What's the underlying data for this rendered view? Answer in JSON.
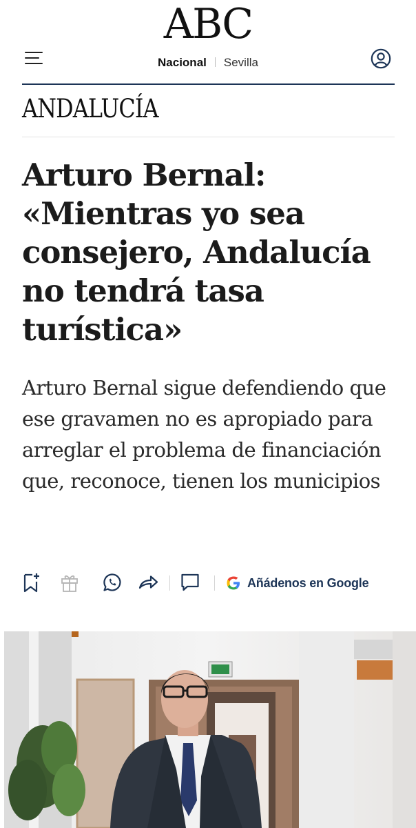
{
  "header": {
    "logo": "ABC",
    "edition": "Nacional",
    "city": "Sevilla",
    "menu_icon": "hamburger-menu-icon",
    "user_icon": "user-account-icon"
  },
  "section": "ANDALUCÍA",
  "article": {
    "headline": "Arturo Bernal: «Mientras yo sea consejero, Andalucía no tendrá tasa turística»",
    "subtitle": "Arturo Bernal sigue defendiendo que ese gravamen no es apropiado para arreglar el problema de financiación que, reconoce, tienen los municipios"
  },
  "share_bar": {
    "icons": [
      "bookmark-add-icon",
      "gift-icon",
      "whatsapp-icon",
      "share-icon",
      "comment-icon",
      "google-icon"
    ],
    "google_label": "Añádenos en Google"
  },
  "colors": {
    "brand_navy": "#1d3557",
    "text": "#1b1b1b",
    "divider": "#e2e2e2"
  }
}
